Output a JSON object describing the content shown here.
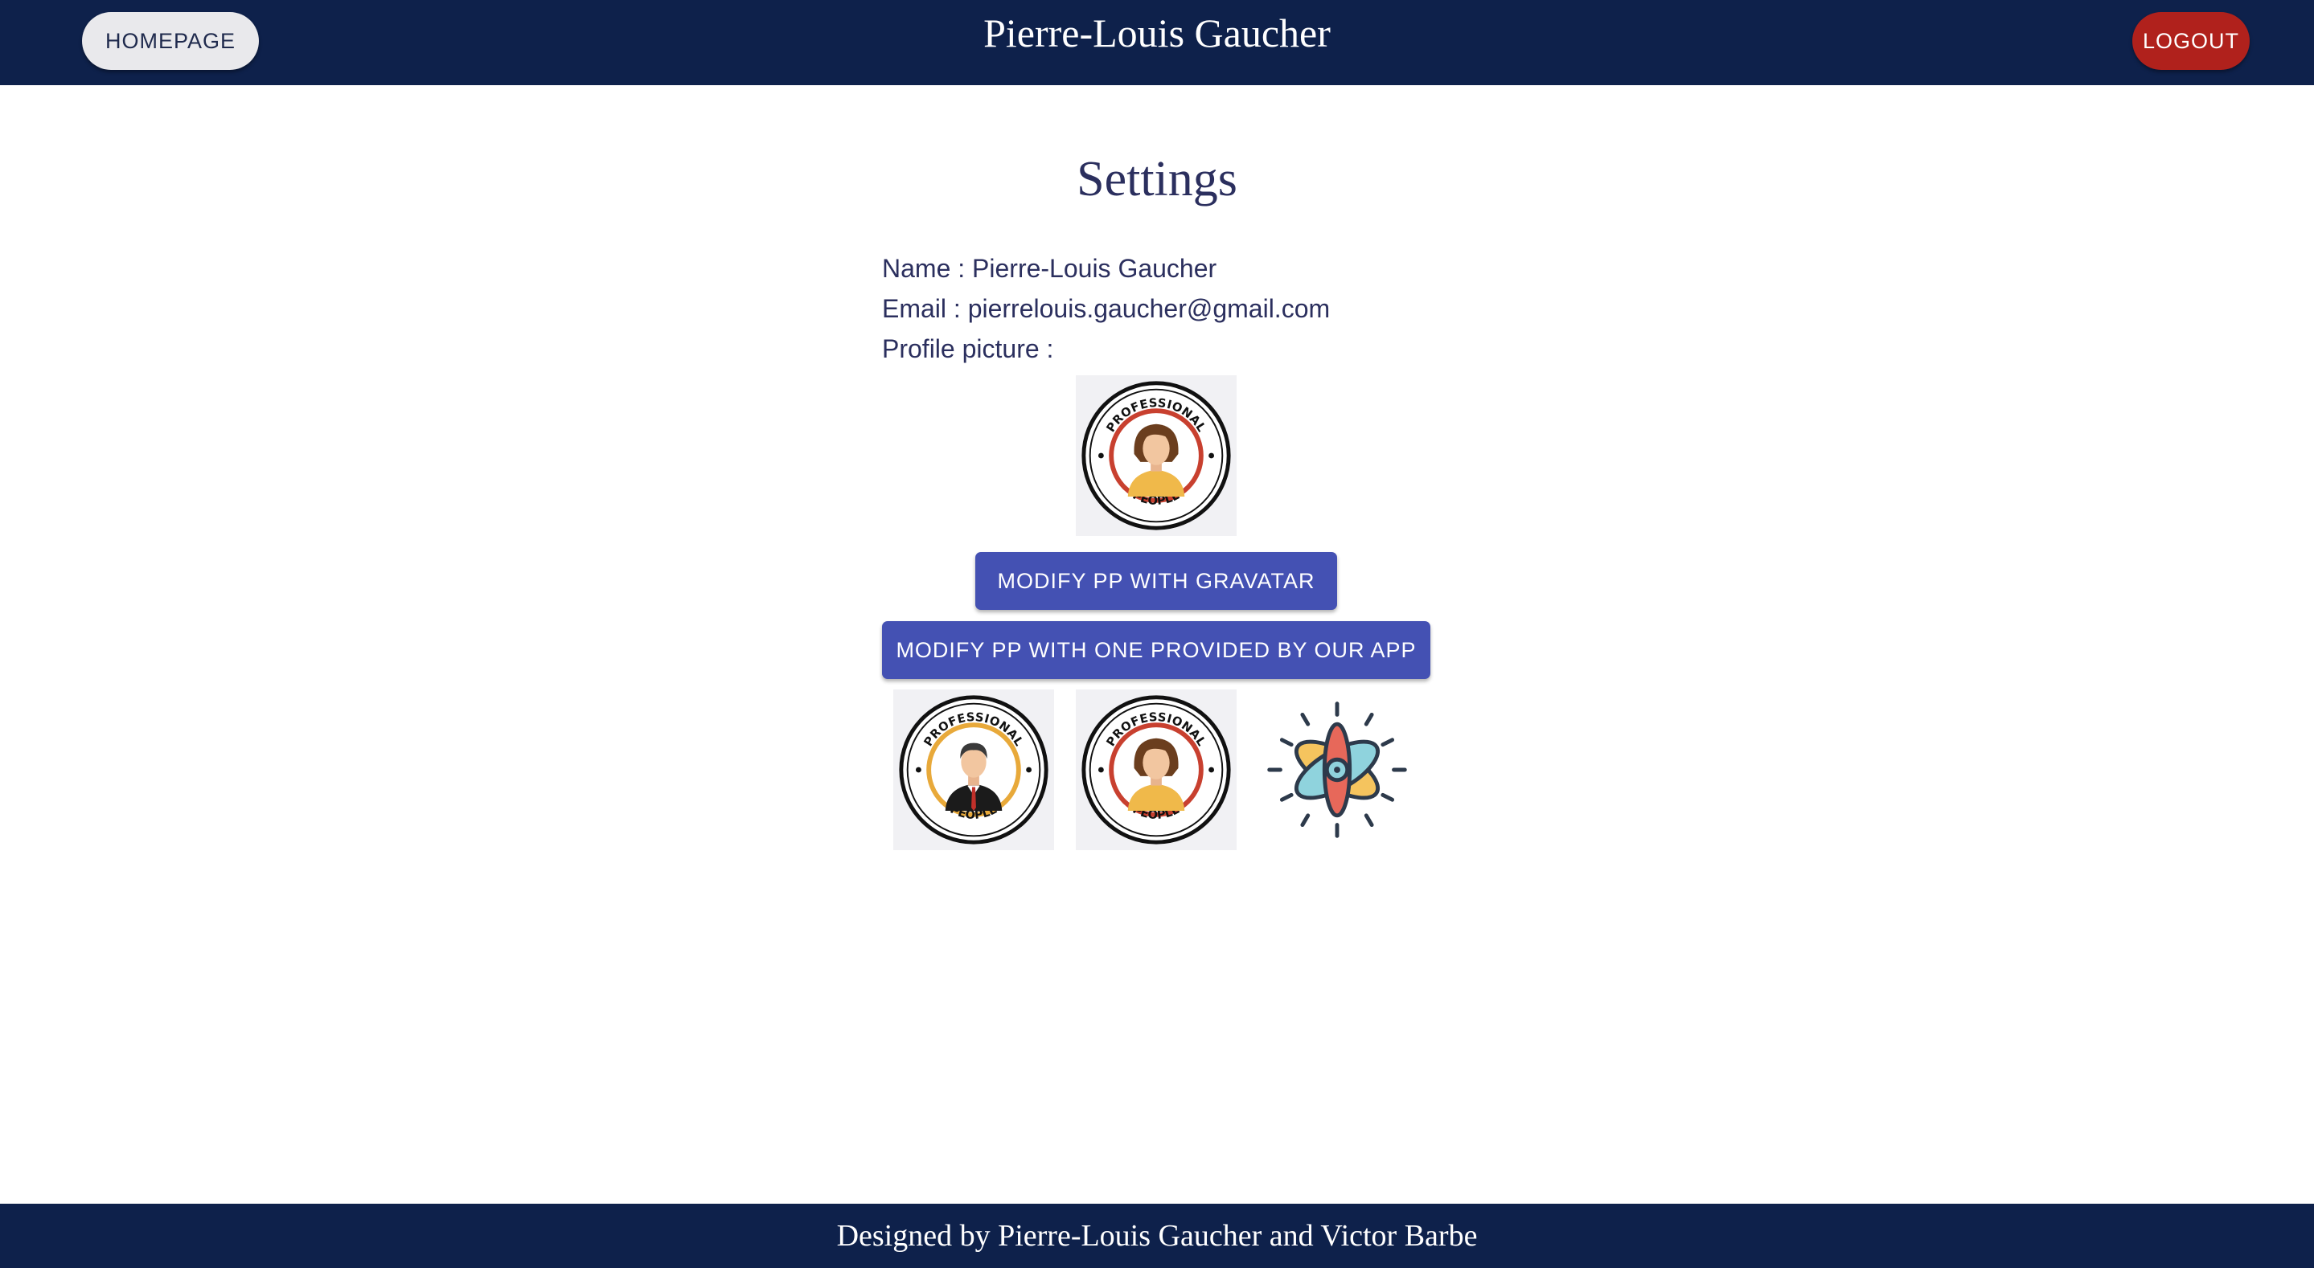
{
  "header": {
    "homepage_label": "HOMEPAGE",
    "title": "Pierre-Louis Gaucher",
    "logout_label": "LOGOUT"
  },
  "settings": {
    "title": "Settings",
    "name_line": "Name : Pierre-Louis Gaucher",
    "email_line": "Email : pierrelouis.gaucher@gmail.com",
    "picture_line": "Profile picture :"
  },
  "avatar_badge": {
    "top_text": "PROFESSIONAL",
    "bottom_text": "PEOPLE"
  },
  "buttons": {
    "gravatar_label": "MODIFY PP WITH GRAVATAR",
    "provided_label": "MODIFY PP WITH ONE PROVIDED BY OUR APP"
  },
  "avatar_options": [
    {
      "icon": "professional-man-avatar"
    },
    {
      "icon": "professional-woman-avatar"
    },
    {
      "icon": "react-atom-logo"
    }
  ],
  "footer": {
    "text": "Designed by Pierre-Louis Gaucher and Victor Barbe"
  },
  "colors": {
    "navbar": "#0e214b",
    "primary_button": "#4451b3",
    "logout_button": "#b0211c",
    "text": "#2b2f5e"
  }
}
